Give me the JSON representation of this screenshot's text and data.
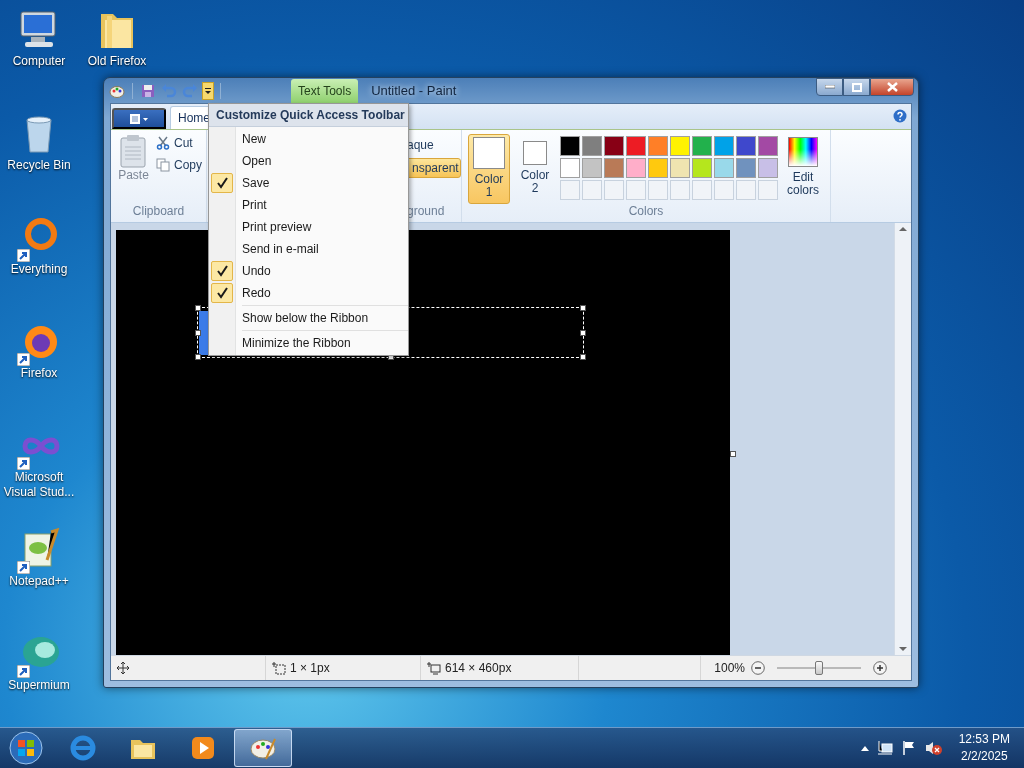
{
  "desktop": {
    "icon_columns": [
      [
        {
          "label": "Computer",
          "kind": "computer",
          "shortcut": false
        },
        {
          "label": "Recycle Bin",
          "kind": "recycle",
          "shortcut": false
        },
        {
          "label": "Everything",
          "kind": "ring",
          "shortcut": true
        },
        {
          "label": "Firefox",
          "kind": "firefox",
          "shortcut": true
        },
        {
          "label": "Microsoft Visual Stud...",
          "kind": "infinity",
          "shortcut": true
        },
        {
          "label": "Notepad++",
          "kind": "notepad",
          "shortcut": true
        },
        {
          "label": "Supermium",
          "kind": "orb",
          "shortcut": true
        }
      ],
      [
        {
          "label": "Old Firefox",
          "kind": "folder",
          "shortcut": false
        }
      ]
    ]
  },
  "window": {
    "title": "Untitled - Paint",
    "contextual_tab": "Text Tools",
    "quick_access": {
      "customize_open": true
    },
    "ribbon_tabs": [
      {
        "label": "Home",
        "selected": true
      }
    ],
    "ribbon": {
      "clipboard": {
        "label": "Clipboard",
        "paste": "Paste",
        "cut": "Cut",
        "copy": "Copy"
      },
      "background": {
        "label": "ground",
        "opaque": "aque",
        "transparent": {
          "label": "nsparent",
          "selected": true
        }
      },
      "colors": {
        "label": "Colors",
        "color1": {
          "label": "Color 1",
          "selected": true,
          "color": "#ffffff"
        },
        "color2": {
          "label": "Color 2",
          "selected": false,
          "color": "#ffffff"
        },
        "palette": [
          {
            "color": "#000000"
          },
          {
            "color": "#7f7f7f"
          },
          {
            "color": "#880015"
          },
          {
            "color": "#ed1c24"
          },
          {
            "color": "#ff7f27"
          },
          {
            "color": "#fff200"
          },
          {
            "color": "#22b14c"
          },
          {
            "color": "#00a2e8"
          },
          {
            "color": "#3f48cc"
          },
          {
            "color": "#a349a4"
          },
          {
            "color": "#ffffff"
          },
          {
            "color": "#c3c3c3"
          },
          {
            "color": "#b97a57"
          },
          {
            "color": "#ffaec9"
          },
          {
            "color": "#ffc90e"
          },
          {
            "color": "#efe4b0"
          },
          {
            "color": "#b5e61d"
          },
          {
            "color": "#99d9ea"
          },
          {
            "color": "#7092be"
          },
          {
            "color": "#c8bfe7"
          }
        ],
        "edit_colors": "Edit colors"
      }
    },
    "menu": {
      "title": "Customize Quick Access Toolbar",
      "items": [
        {
          "label": "New",
          "kind": "command",
          "checked": false
        },
        {
          "label": "Open",
          "kind": "command",
          "checked": false
        },
        {
          "label": "Save",
          "kind": "command",
          "checked": true
        },
        {
          "label": "Print",
          "kind": "command",
          "checked": false
        },
        {
          "label": "Print preview",
          "kind": "command",
          "checked": false
        },
        {
          "label": "Send in e-mail",
          "kind": "command",
          "checked": false
        },
        {
          "label": "Undo",
          "kind": "command",
          "checked": true
        },
        {
          "label": "Redo",
          "kind": "command",
          "checked": true
        },
        {
          "label": "Show below the Ribbon",
          "kind": "option",
          "checked": false
        },
        {
          "label": "Minimize the Ribbon",
          "kind": "option",
          "checked": false
        }
      ]
    },
    "status_bar": {
      "selection_size": "1 × 1px",
      "canvas_size": "614 × 460px",
      "zoom": "100%",
      "zoom_slider": {
        "level": 0.5
      }
    }
  },
  "taskbar": {
    "buttons": [
      {
        "kind": "browser",
        "selected": false
      },
      {
        "kind": "explorer",
        "selected": false
      },
      {
        "kind": "media",
        "selected": false
      },
      {
        "kind": "paint",
        "selected": true
      }
    ],
    "clock": {
      "time": "12:53 PM",
      "date": "2/2/2025"
    }
  }
}
